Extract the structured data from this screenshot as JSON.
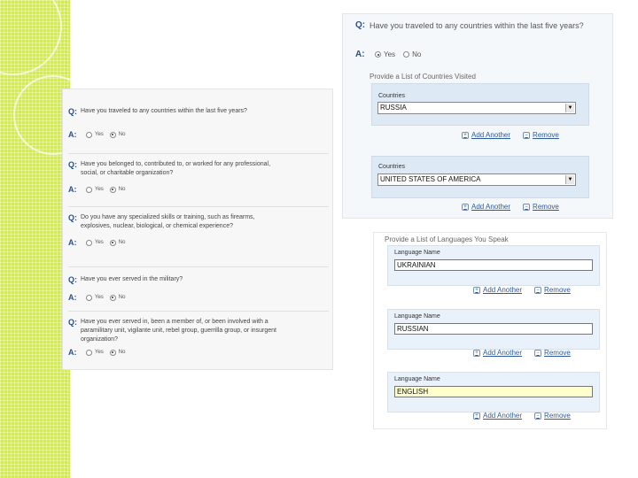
{
  "qa_panel": {
    "q_label": "Q:",
    "a_label": "A:",
    "questions": [
      {
        "text": "Have you traveled to any countries within the last five years?",
        "yes": "Yes",
        "no": "No",
        "selected": "no"
      },
      {
        "text": "Have you belonged to, contributed to, or worked for any professional, social, or charitable organization?",
        "yes": "Yes",
        "no": "No",
        "selected": "no"
      },
      {
        "text": "Do you have any specialized skills or training, such as firearms, explosives, nuclear, biological, or chemical experience?",
        "yes": "Yes",
        "no": "No",
        "selected": "no"
      },
      {
        "text": "Have you ever served in the military?",
        "yes": "Yes",
        "no": "No",
        "selected": "no"
      },
      {
        "text": "Have you ever served in, been a member of, or been involved with a paramilitary unit, vigilante unit, rebel group, guerrilla group, or insurgent organization?",
        "yes": "Yes",
        "no": "No",
        "selected": "no"
      }
    ]
  },
  "countries_panel": {
    "question": "Have you traveled to any countries within the last five years?",
    "q_label": "Q:",
    "a_label": "A:",
    "yes": "Yes",
    "no": "No",
    "selected": "yes",
    "subhead": "Provide a List of Countries Visited",
    "field_label": "Countries",
    "entries": [
      "RUSSIA",
      "UNITED STATES OF AMERICA"
    ],
    "add_label": "Add Another",
    "remove_label": "Remove"
  },
  "languages_panel": {
    "subhead": "Provide a List of Languages You Speak",
    "field_label": "Language Name",
    "entries": [
      "UKRAINIAN",
      "RUSSIAN",
      "ENGLISH"
    ],
    "add_label": "Add Another",
    "remove_label": "Remove"
  },
  "colors": {
    "accent_strip": "#d4ee3c",
    "link": "#2c5a9c",
    "label": "#2a4f8a",
    "field_box": "#dde9f5"
  }
}
